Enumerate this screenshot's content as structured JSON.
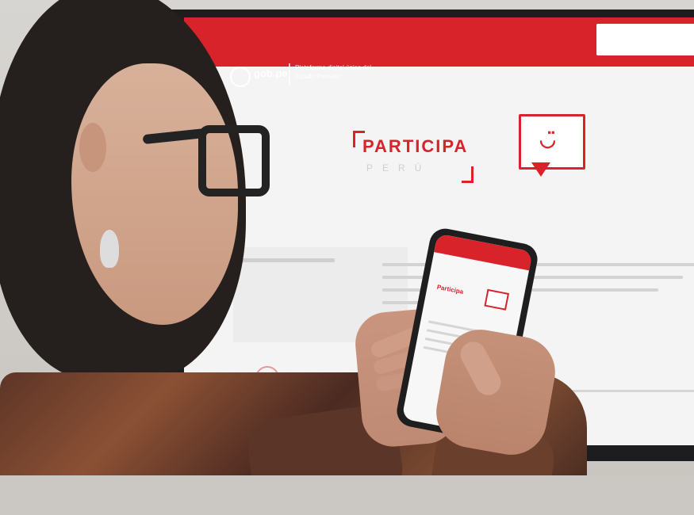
{
  "header": {
    "brand": "gob.pe",
    "tagline": "Plataforma digital única del Estado Peruano"
  },
  "hero": {
    "title": "PARTICIPA",
    "subtitle": "PERÚ"
  },
  "phone": {
    "title": "Participa"
  }
}
